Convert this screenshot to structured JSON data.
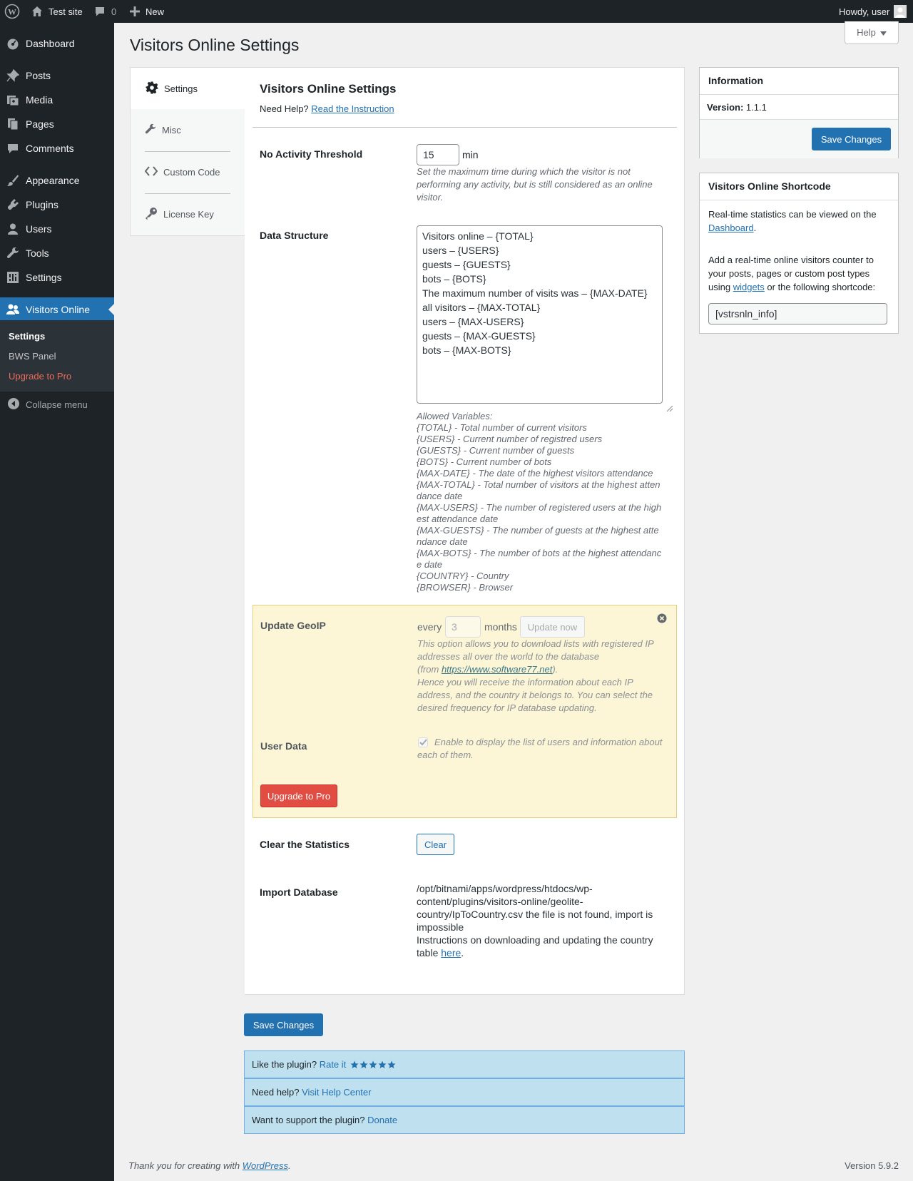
{
  "adminbar": {
    "site_name": "Test site",
    "comments_count": "0",
    "new_label": "New",
    "howdy": "Howdy, user"
  },
  "menu": {
    "items": [
      {
        "label": "Dashboard",
        "icon": "dashboard-icon"
      },
      {
        "label": "Posts",
        "icon": "pin-icon"
      },
      {
        "label": "Media",
        "icon": "media-icon"
      },
      {
        "label": "Pages",
        "icon": "pages-icon"
      },
      {
        "label": "Comments",
        "icon": "comment-icon"
      },
      {
        "label": "Appearance",
        "icon": "brush-icon"
      },
      {
        "label": "Plugins",
        "icon": "plug-icon"
      },
      {
        "label": "Users",
        "icon": "user-icon"
      },
      {
        "label": "Tools",
        "icon": "wrench-icon"
      },
      {
        "label": "Settings",
        "icon": "settings-icon"
      },
      {
        "label": "Visitors Online",
        "icon": "groups-icon"
      }
    ],
    "submenu": [
      "Settings",
      "BWS Panel",
      "Upgrade to Pro"
    ],
    "collapse": "Collapse menu"
  },
  "page": {
    "title": "Visitors Online Settings",
    "help": "Help"
  },
  "tabs": [
    "Settings",
    "Misc",
    "Custom Code",
    "License Key"
  ],
  "panel": {
    "heading": "Visitors Online Settings",
    "need_help": "Need Help?",
    "instruction_link": "Read the Instruction",
    "no_activity": {
      "label": "No Activity Threshold",
      "value": "15",
      "unit": "min",
      "desc": "Set the maximum time during which the visitor is not performing any activity, but is still considered as an online visitor."
    },
    "data_structure": {
      "label": "Data Structure",
      "value": "Visitors online – {TOTAL}\nusers – {USERS}\nguests – {GUESTS}\nbots – {BOTS}\nThe maximum number of visits was – {MAX-DATE}\nall visitors – {MAX-TOTAL}\nusers – {MAX-USERS}\nguests – {MAX-GUESTS}\nbots – {MAX-BOTS}",
      "allowed": [
        "Allowed Variables:",
        "{TOTAL} - Total number of current visitors",
        "{USERS} - Current number of registred users",
        "{GUESTS} - Current number of guests",
        "{BOTS} - Current number of bots",
        "{MAX-DATE} - The date of the highest visitors attendance",
        "{MAX-TOTAL} - Total number of visitors at the highest atten",
        "dance date",
        "{MAX-USERS} - The number of registered users at the high",
        "est attendance date",
        "{MAX-GUESTS} - The number of guests at the highest atte",
        "ndance date",
        "{MAX-BOTS} - The number of bots at the highest attendanc",
        "e date",
        "{COUNTRY} - Country",
        "{BROWSER} - Browser"
      ]
    },
    "geoip": {
      "label": "Update GeoIP",
      "every": "every",
      "value": "3",
      "months": "months",
      "update_now": "Update now",
      "desc1": "This option allows you to download lists with registered IP addresses all over the world to the database",
      "from_pre": "(from ",
      "from_link": "https://www.software77.net",
      "from_post": ").",
      "desc2": "Hence you will receive the information about each IP address, and the country it belongs to. You can select the desired frequency for IP database updating."
    },
    "user_data": {
      "label": "User Data",
      "desc": "Enable to display the list of users and information about each of them."
    },
    "upgrade": "Upgrade to Pro",
    "clear": {
      "label": "Clear the Statistics",
      "button": "Clear"
    },
    "import": {
      "label": "Import Database",
      "message": "/opt/bitnami/apps/wordpress/htdocs/wp-content/plugins/visitors-online/geolite-country/IpToCountry.csv the file is not found, import is impossible",
      "instructions": "Instructions on downloading and updating the country table",
      "here": "here",
      "period": "."
    }
  },
  "save_changes": "Save Changes",
  "info_box": {
    "title": "Information",
    "version_label": "Version:",
    "version_value": "1.1.1",
    "save": "Save Changes"
  },
  "shortcode_box": {
    "title": "Visitors Online Shortcode",
    "text1_pre": "Real-time statistics can be viewed on the ",
    "text1_link": "Dashboard",
    "text1_post": ".",
    "text2_pre": "Add a real-time online visitors counter to your posts, pages or custom post types using ",
    "text2_link": "widgets",
    "text2_post": " or the following shortcode:",
    "shortcode": "[vstrsnln_info]"
  },
  "rate_bars": [
    {
      "text": "Like the plugin?",
      "link": "Rate it",
      "stars": 5
    },
    {
      "text": "Need help?",
      "link": "Visit Help Center"
    },
    {
      "text": "Want to support the plugin?",
      "link": "Donate"
    }
  ],
  "footer": {
    "thanks_pre": "Thank you for creating with ",
    "thanks_link": "WordPress",
    "thanks_post": ".",
    "version": "Version 5.9.2"
  },
  "colors": {
    "admin_bg": "#1d2327",
    "accent": "#2271b1",
    "upgrade": "#d63638",
    "pro_box": "#fcf6d6",
    "rate_bar": "#bee0ef"
  }
}
